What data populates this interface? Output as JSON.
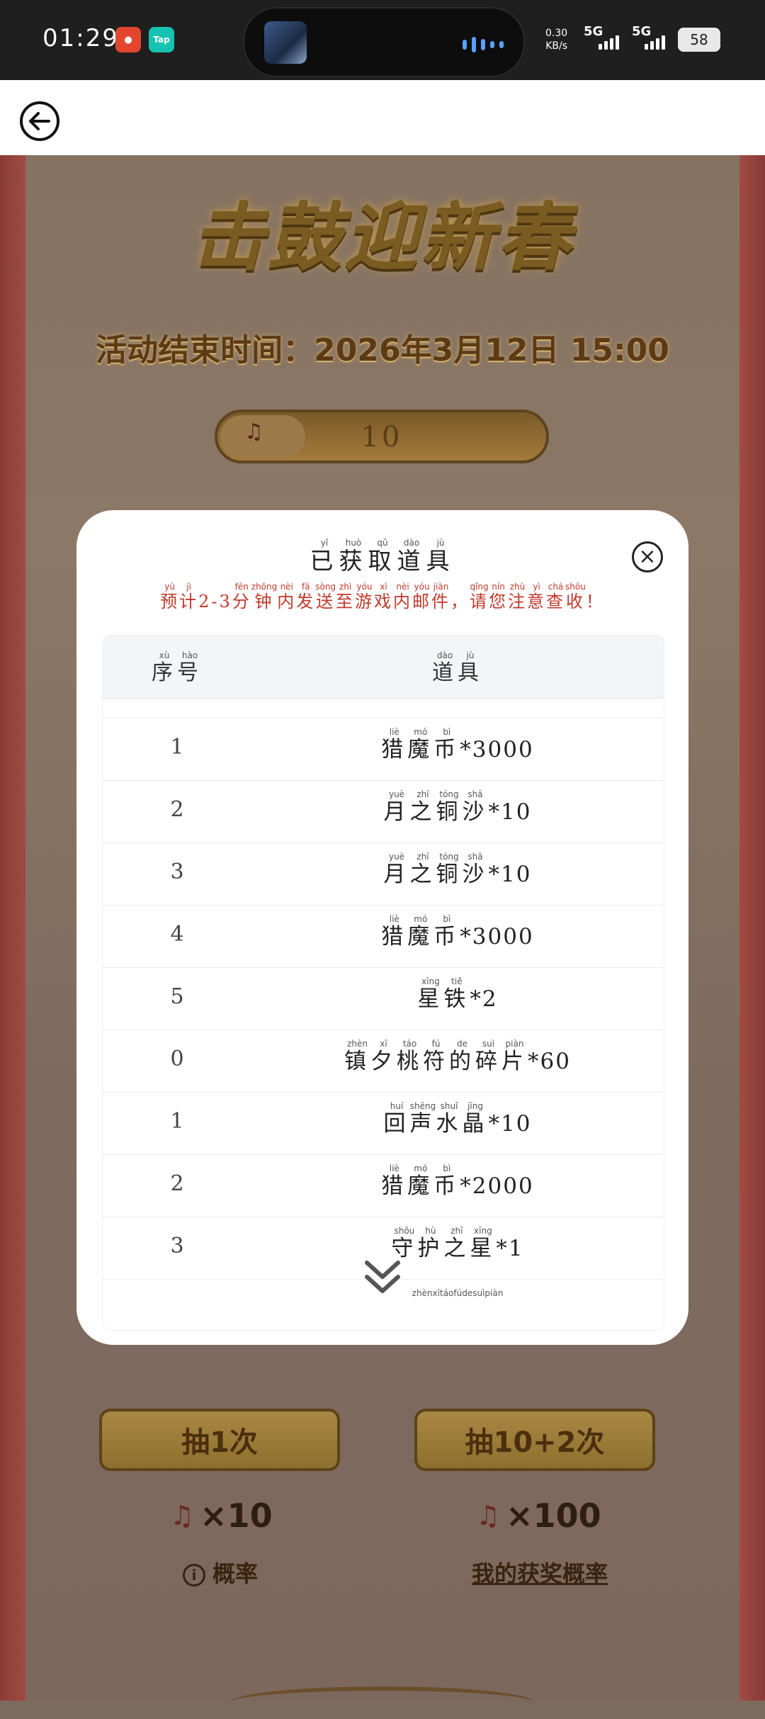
{
  "status_bar": {
    "time": "01:29",
    "app_icon_2": "Tap",
    "net_speed": "0.30",
    "net_unit": "KB/s",
    "sim1": "5G",
    "sim2": "5G",
    "battery": "58"
  },
  "game": {
    "title": "击鼓迎新春",
    "end_time": "活动结束时间：2026年3月12日 15:00",
    "ticket_count": "10",
    "draw_once_label": "抽1次",
    "draw_ten_label": "抽10+2次",
    "cost_once": "×10",
    "cost_ten": "×100",
    "prob_label": "概率",
    "my_prob_label": "我的获奖概率"
  },
  "modal": {
    "title_chars": [
      {
        "c": "已",
        "p": "yǐ"
      },
      {
        "c": "获",
        "p": "huò"
      },
      {
        "c": "取",
        "p": "qǔ"
      },
      {
        "c": "道",
        "p": "dào"
      },
      {
        "c": "具",
        "p": "jù"
      }
    ],
    "notice_chars": [
      {
        "c": "预",
        "p": "yù"
      },
      {
        "c": "计",
        "p": "jì"
      },
      {
        "c": "2-3",
        "p": ""
      },
      {
        "c": "分",
        "p": "fēn"
      },
      {
        "c": "钟",
        "p": "zhōng"
      },
      {
        "c": "内",
        "p": "nèi"
      },
      {
        "c": "发",
        "p": "fā"
      },
      {
        "c": "送",
        "p": "sòng"
      },
      {
        "c": "至",
        "p": "zhì"
      },
      {
        "c": "游",
        "p": "yóu"
      },
      {
        "c": "戏",
        "p": "xì"
      },
      {
        "c": "内",
        "p": "nèi"
      },
      {
        "c": "邮",
        "p": "yóu"
      },
      {
        "c": "件",
        "p": "jiàn"
      },
      {
        "c": "，",
        "p": ""
      },
      {
        "c": "请",
        "p": "qǐng"
      },
      {
        "c": "您",
        "p": "nín"
      },
      {
        "c": "注",
        "p": "zhù"
      },
      {
        "c": "意",
        "p": "yì"
      },
      {
        "c": "查",
        "p": "chá"
      },
      {
        "c": "收",
        "p": "shōu"
      },
      {
        "c": "！",
        "p": ""
      }
    ],
    "col_index": [
      {
        "c": "序",
        "p": "xù"
      },
      {
        "c": "号",
        "p": "hào"
      }
    ],
    "col_item": [
      {
        "c": "道",
        "p": "dào"
      },
      {
        "c": "具",
        "p": "jù"
      }
    ],
    "rows": [
      {
        "index": "0",
        "item": [
          {
            "c": "镇",
            "p": ""
          },
          {
            "c": "夕",
            "p": ""
          },
          {
            "c": "桃",
            "p": ""
          },
          {
            "c": "符",
            "p": ""
          },
          {
            "c": "的",
            "p": ""
          },
          {
            "c": "碎",
            "p": ""
          },
          {
            "c": "片",
            "p": ""
          }
        ],
        "qty": "*60"
      },
      {
        "index": "1",
        "item": [
          {
            "c": "猎",
            "p": "liè"
          },
          {
            "c": "魔",
            "p": "mó"
          },
          {
            "c": "币",
            "p": "bì"
          }
        ],
        "qty": "*3000"
      },
      {
        "index": "2",
        "item": [
          {
            "c": "月",
            "p": "yuè"
          },
          {
            "c": "之",
            "p": "zhī"
          },
          {
            "c": "铜",
            "p": "tóng"
          },
          {
            "c": "沙",
            "p": "shā"
          }
        ],
        "qty": "*10"
      },
      {
        "index": "3",
        "item": [
          {
            "c": "月",
            "p": "yuè"
          },
          {
            "c": "之",
            "p": "zhī"
          },
          {
            "c": "铜",
            "p": "tóng"
          },
          {
            "c": "沙",
            "p": "shā"
          }
        ],
        "qty": "*10"
      },
      {
        "index": "4",
        "item": [
          {
            "c": "猎",
            "p": "liè"
          },
          {
            "c": "魔",
            "p": "mó"
          },
          {
            "c": "币",
            "p": "bì"
          }
        ],
        "qty": "*3000"
      },
      {
        "index": "5",
        "item": [
          {
            "c": "星",
            "p": "xīng"
          },
          {
            "c": "铁",
            "p": "tiě"
          }
        ],
        "qty": "*2"
      },
      {
        "index": "0",
        "item": [
          {
            "c": "镇",
            "p": "zhèn"
          },
          {
            "c": "夕",
            "p": "xī"
          },
          {
            "c": "桃",
            "p": "táo"
          },
          {
            "c": "符",
            "p": "fú"
          },
          {
            "c": "的",
            "p": "de"
          },
          {
            "c": "碎",
            "p": "suì"
          },
          {
            "c": "片",
            "p": "piàn"
          }
        ],
        "qty": "*60"
      },
      {
        "index": "1",
        "item": [
          {
            "c": "回",
            "p": "huí"
          },
          {
            "c": "声",
            "p": "shēng"
          },
          {
            "c": "水",
            "p": "shuǐ"
          },
          {
            "c": "晶",
            "p": "jīng"
          }
        ],
        "qty": "*10"
      },
      {
        "index": "2",
        "item": [
          {
            "c": "猎",
            "p": "liè"
          },
          {
            "c": "魔",
            "p": "mó"
          },
          {
            "c": "币",
            "p": "bì"
          }
        ],
        "qty": "*2000"
      },
      {
        "index": "3",
        "item": [
          {
            "c": "守",
            "p": "shǒu"
          },
          {
            "c": "护",
            "p": "hù"
          },
          {
            "c": "之",
            "p": "zhī"
          },
          {
            "c": "星",
            "p": "xīng"
          }
        ],
        "qty": "*1"
      },
      {
        "index": "",
        "item": [
          {
            "c": "",
            "p": "zhèn"
          },
          {
            "c": "",
            "p": "xī"
          },
          {
            "c": "",
            "p": "táo"
          },
          {
            "c": "",
            "p": "fú"
          },
          {
            "c": "",
            "p": "de"
          },
          {
            "c": "",
            "p": "suì"
          },
          {
            "c": "",
            "p": "piàn"
          }
        ],
        "qty": ""
      }
    ]
  }
}
